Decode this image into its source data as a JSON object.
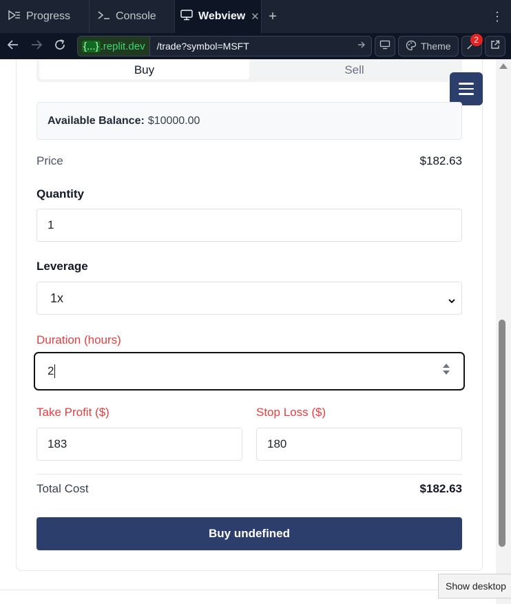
{
  "tabs": [
    {
      "label": "Progress",
      "icon": "progress-icon"
    },
    {
      "label": "Console",
      "icon": "console-icon"
    },
    {
      "label": "Webview",
      "icon": "monitor-icon",
      "active": true
    }
  ],
  "toolbar": {
    "url_host_braces": "{...}",
    "url_host_suffix": ".replit.dev",
    "url_path": "/trade?symbol=MSFT",
    "theme_label": "Theme",
    "notification_count": "2"
  },
  "trade": {
    "side_tabs": [
      "Buy",
      "Sell"
    ],
    "active_side": "Buy",
    "balance_label": "Available Balance:",
    "balance_value": "$10000.00",
    "price_label": "Price",
    "price_value": "$182.63",
    "quantity_label": "Quantity",
    "quantity_value": "1",
    "leverage_label": "Leverage",
    "leverage_value": "1x",
    "duration_label": "Duration (hours)",
    "duration_value": "2",
    "take_profit_label": "Take Profit ($)",
    "take_profit_value": "183",
    "stop_loss_label": "Stop Loss ($)",
    "stop_loss_value": "180",
    "total_label": "Total Cost",
    "total_value": "$182.63",
    "submit_label": "Buy undefined"
  },
  "tooltip": "Show desktop",
  "colors": {
    "primary": "#2c3e6b",
    "error": "#e53e3e",
    "ide_bg": "#0e1525"
  }
}
